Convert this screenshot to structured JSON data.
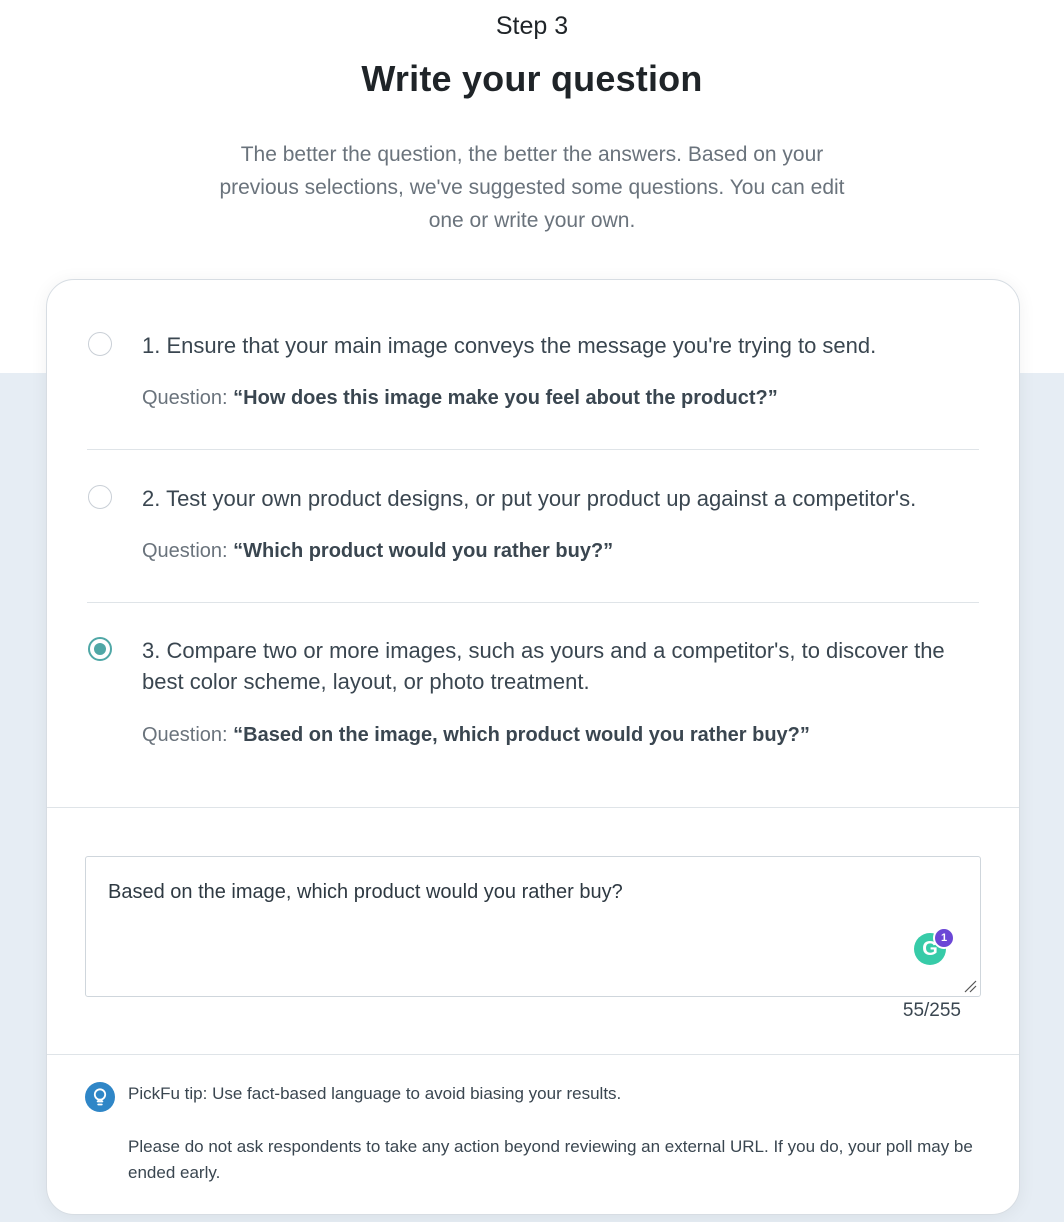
{
  "header": {
    "step": "Step 3",
    "title": "Write your question",
    "subtitle": "The better the question, the better the answers. Based on your previous selections, we've suggested some questions. You can edit one or write your own."
  },
  "options": [
    {
      "text": "1. Ensure that your main image conveys the message you're trying to send.",
      "question_label": "Question:",
      "question": "“How does this image make you feel about the product?”",
      "selected": false
    },
    {
      "text": "2. Test your own product designs, or put your product up against a competitor's.",
      "question_label": "Question:",
      "question": "“Which product would you rather buy?”",
      "selected": false
    },
    {
      "text": "3. Compare two or more images, such as yours and a competitor's, to discover the best color scheme, layout, or photo treatment.",
      "question_label": "Question:",
      "question": "“Based on the image, which product would you rather buy?”",
      "selected": true
    }
  ],
  "question_input": {
    "value": "Based on the image, which product would you rather buy?",
    "char_count": "55/255",
    "grammarly_letter": "G",
    "grammarly_count": "1"
  },
  "tip": {
    "text": "PickFu tip: Use fact-based language to avoid biasing your results.",
    "warning": "Please do not ask respondents to take any action beyond reviewing an external URL. If you do, your poll may be ended early."
  },
  "colors": {
    "accent_teal": "#4fa7a6",
    "tip_blue": "#2f86c7",
    "background_bottom": "#e6edf4",
    "grammarly_green": "#15c39a",
    "grammarly_badge": "#6b47d6"
  },
  "icons": {
    "tip": "lightbulb-icon",
    "grammarly": "grammarly-icon",
    "resize": "resize-handle-icon"
  }
}
